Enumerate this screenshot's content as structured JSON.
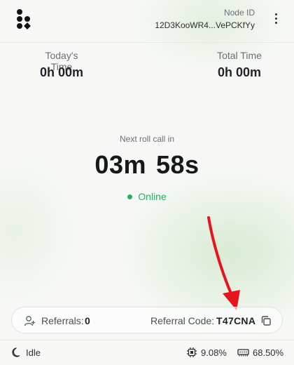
{
  "header": {
    "node_id_label": "Node ID",
    "node_id_value": "12D3KooWR4...VePCKfYy"
  },
  "stats": {
    "today_label": "Today's Time",
    "today_value": "0h 00m",
    "total_label": "Total Time",
    "total_value": "0h 00m"
  },
  "rollcall": {
    "label": "Next roll call in",
    "minutes": "03m",
    "seconds": "58s",
    "status": "Online"
  },
  "referral": {
    "label": "Referrals:",
    "count": "0",
    "code_label": "Referral Code:",
    "code": "T47CNA"
  },
  "footer": {
    "state": "Idle",
    "cpu": "9.08%",
    "ram": "68.50%"
  },
  "icons": {
    "logo": "logo-icon",
    "menu": "more-vertical-icon",
    "referral": "add-user-icon",
    "copy": "copy-icon",
    "idle": "moon-icon",
    "cpu": "cpu-icon",
    "ram": "memory-icon"
  },
  "colors": {
    "online": "#23b25a",
    "arrow": "#e8141c"
  }
}
